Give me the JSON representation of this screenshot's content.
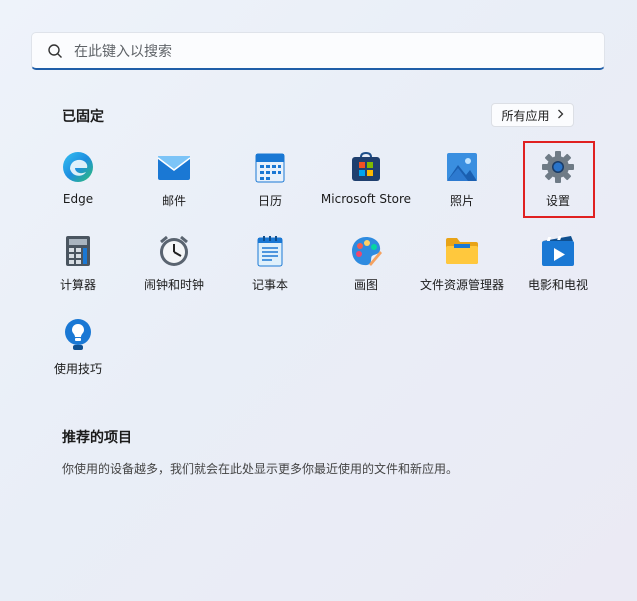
{
  "search": {
    "placeholder": "在此键入以搜索"
  },
  "pinned": {
    "title": "已固定",
    "all_apps_label": "所有应用",
    "apps": [
      {
        "label": "Edge",
        "icon": "edge-icon"
      },
      {
        "label": "邮件",
        "icon": "mail-icon"
      },
      {
        "label": "日历",
        "icon": "calendar-icon"
      },
      {
        "label": "Microsoft Store",
        "icon": "store-icon"
      },
      {
        "label": "照片",
        "icon": "photos-icon"
      },
      {
        "label": "设置",
        "icon": "settings-gear-icon"
      },
      {
        "label": "计算器",
        "icon": "calculator-icon"
      },
      {
        "label": "闹钟和时钟",
        "icon": "alarm-clock-icon"
      },
      {
        "label": "记事本",
        "icon": "notepad-icon"
      },
      {
        "label": "画图",
        "icon": "paint-palette-icon"
      },
      {
        "label": "文件资源管理器",
        "icon": "folder-icon"
      },
      {
        "label": "电影和电视",
        "icon": "movies-tv-icon"
      },
      {
        "label": "使用技巧",
        "icon": "tips-lightbulb-icon"
      }
    ]
  },
  "recommended": {
    "title": "推荐的项目",
    "text": "你使用的设备越多，我们就会在此处显示更多你最近使用的文件和新应用。"
  },
  "colors": {
    "accent": "#1f5ea8",
    "highlight": "#e02020"
  }
}
